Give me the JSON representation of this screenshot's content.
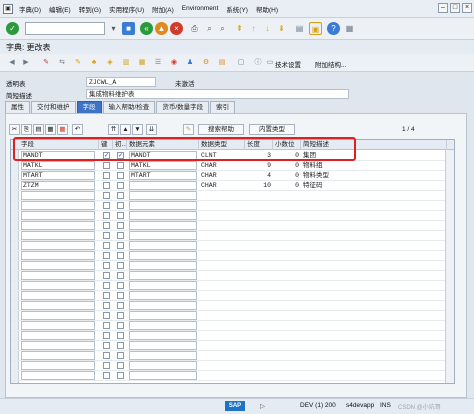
{
  "menubar": {
    "items": [
      "字典(D)",
      "编辑(E)",
      "转到(G)",
      "实用程序(U)",
      "附加(A)",
      "Environment",
      "系统(Y)",
      "帮助(H)"
    ]
  },
  "toolbar": {
    "command_value": ""
  },
  "title": "字典: 更改表",
  "app_toolbar": {
    "tech_settings": "技术设置",
    "append_structure": "附加结构..."
  },
  "header": {
    "transparent_table_label": "透明表",
    "table_name": "ZJCWL_A",
    "status": "未激活",
    "short_desc_label": "简短描述",
    "short_desc": "集成物料维护表"
  },
  "tabs": [
    "属性",
    "交付和维护",
    "字段",
    "输入帮助/检查",
    "货币/数量字段",
    "索引"
  ],
  "active_tab": "字段",
  "table_toolbar": {
    "search_help_btn": "搜索帮助",
    "builtin_type_btn": "内置类型",
    "page_indicator": "1 / 4"
  },
  "grid": {
    "columns": [
      "字段",
      "键",
      "初...",
      "数据元素",
      "数据类型",
      "长度",
      "小数位",
      "简短描述"
    ],
    "rows": [
      {
        "field": "MANDT",
        "key": true,
        "init": true,
        "element": "MANDT",
        "type": "CLNT",
        "length": "3",
        "decimals": "0",
        "desc": "集团"
      },
      {
        "field": "MATKL",
        "key": false,
        "init": false,
        "element": "MATKL",
        "type": "CHAR",
        "length": "9",
        "decimals": "0",
        "desc": "物料组"
      },
      {
        "field": "MTART",
        "key": false,
        "init": false,
        "element": "MTART",
        "type": "CHAR",
        "length": "4",
        "decimals": "0",
        "desc": "物料类型"
      },
      {
        "field": "ZTZM",
        "key": false,
        "init": false,
        "element": "",
        "type": "CHAR",
        "length": "10",
        "decimals": "0",
        "desc": "特征码"
      }
    ]
  },
  "statusbar": {
    "sap": "SAP",
    "system": "DEV (1) 200",
    "server": "s4devapp",
    "mode": "INS"
  },
  "watermark": "CSDN @小坑哥"
}
